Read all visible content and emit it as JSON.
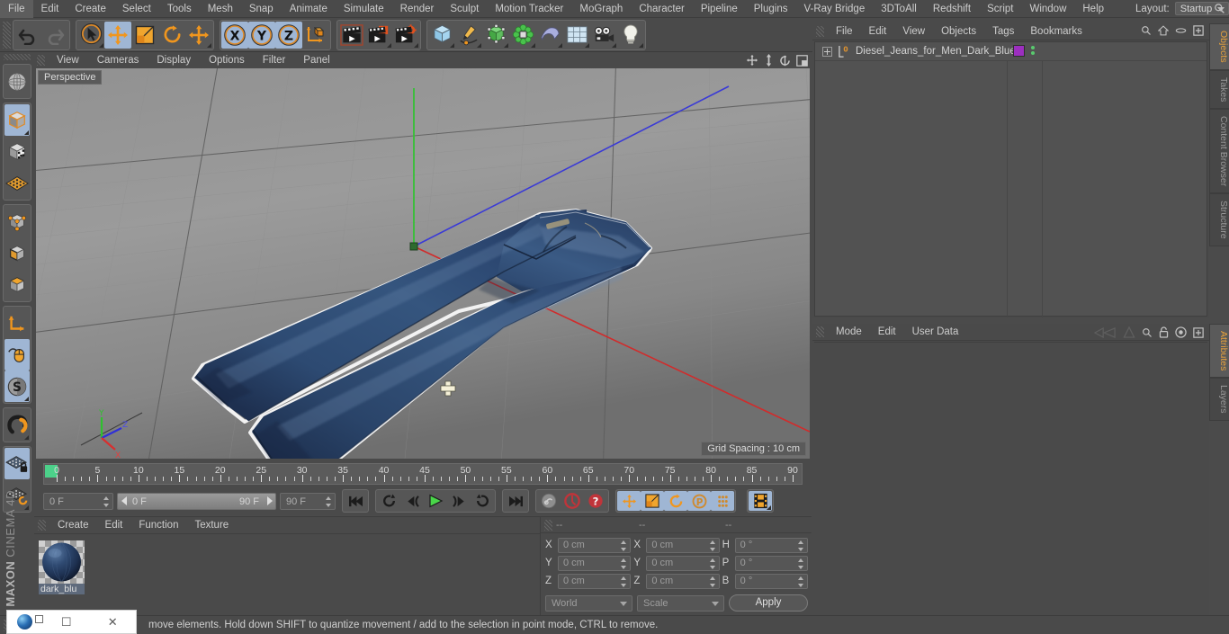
{
  "menubar": {
    "items": [
      "File",
      "Edit",
      "Create",
      "Select",
      "Tools",
      "Mesh",
      "Snap",
      "Animate",
      "Simulate",
      "Render",
      "Sculpt",
      "Motion Tracker",
      "MoGraph",
      "Character",
      "Pipeline",
      "Plugins",
      "V-Ray Bridge",
      "3DToAll",
      "Redshift",
      "Script",
      "Window",
      "Help"
    ],
    "layout_label": "Layout:",
    "layout_value": "Startup"
  },
  "viewport": {
    "menu": [
      "View",
      "Cameras",
      "Display",
      "Options",
      "Filter",
      "Panel"
    ],
    "perspective_label": "Perspective",
    "grid_spacing_label": "Grid Spacing : 10 cm",
    "axis": {
      "x": "X",
      "y": "Y",
      "z": "Z"
    },
    "object_color": "#2c4570",
    "background_color": "#8e8e8e"
  },
  "timeline": {
    "ticks": [
      0,
      5,
      10,
      15,
      20,
      25,
      30,
      35,
      40,
      45,
      50,
      55,
      60,
      65,
      70,
      75,
      80,
      85,
      90
    ],
    "current_frame": "0 F",
    "range_start": "0 F",
    "range_end": "90 F",
    "end_frame": "90 F",
    "preview_frame": "0 F"
  },
  "material_manager": {
    "menu": [
      "Create",
      "Edit",
      "Function",
      "Texture"
    ],
    "materials": [
      {
        "name": "dark_blu",
        "color": "#2c4570"
      }
    ]
  },
  "coordinates": {
    "header": [
      "--",
      "--",
      "--"
    ],
    "rows": [
      {
        "pos_label": "X",
        "pos_value": "0 cm",
        "size_label": "X",
        "size_value": "0 cm",
        "rot_label": "H",
        "rot_value": "0 °"
      },
      {
        "pos_label": "Y",
        "pos_value": "0 cm",
        "size_label": "Y",
        "size_value": "0 cm",
        "rot_label": "P",
        "rot_value": "0 °"
      },
      {
        "pos_label": "Z",
        "pos_value": "0 cm",
        "size_label": "Z",
        "size_value": "0 cm",
        "rot_label": "B",
        "rot_value": "0 °"
      }
    ],
    "system": "World",
    "mode": "Scale",
    "apply_label": "Apply"
  },
  "object_manager": {
    "menu": [
      "File",
      "Edit",
      "View",
      "Objects",
      "Tags",
      "Bookmarks"
    ],
    "objects": [
      {
        "name": "Diesel_Jeans_for_Men_Dark_Blue",
        "tag_color": "#9c2fbf",
        "level": "0"
      }
    ]
  },
  "attribute_manager": {
    "menu": [
      "Mode",
      "Edit",
      "User Data"
    ]
  },
  "right_tabs_top": [
    "Objects",
    "Takes",
    "Content Browser",
    "Structure"
  ],
  "right_tabs_bottom": [
    "Attributes",
    "Layers"
  ],
  "statusbar": {
    "text": "move elements. Hold down SHIFT to quantize movement / add to the selection in point mode, CTRL to remove."
  },
  "taskbar": {
    "minimize": "–",
    "maximize": "☐",
    "close": "✕"
  }
}
